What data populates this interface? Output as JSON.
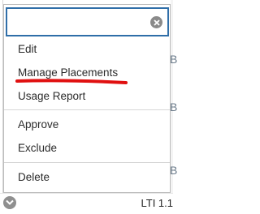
{
  "search": {
    "value": "",
    "placeholder": ""
  },
  "menu": {
    "items": [
      {
        "label": "Edit"
      },
      {
        "label": "Manage Placements"
      },
      {
        "label": "Usage Report"
      },
      {
        "label": "Approve"
      },
      {
        "label": "Exclude"
      },
      {
        "label": "Delete"
      }
    ]
  },
  "background": {
    "row_type": "LTI 1.1",
    "edge_glyph": "B"
  },
  "colors": {
    "focus_border": "#2f6ea8",
    "annotation": "#e01010",
    "icon_gray": "#8a8a8a"
  },
  "icons": {
    "clear": "close-circle-icon",
    "expand": "chevron-down-circle-icon"
  }
}
